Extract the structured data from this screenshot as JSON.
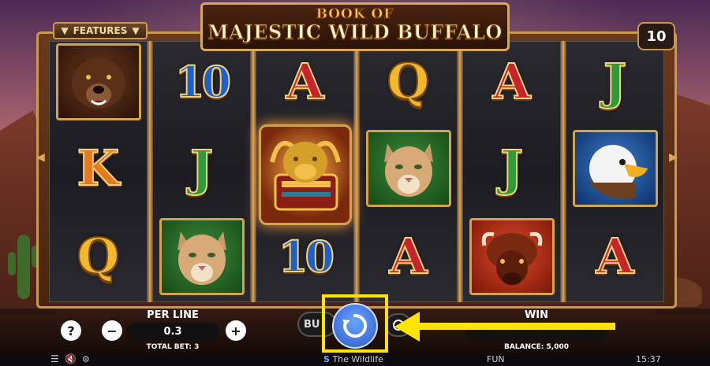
{
  "game": {
    "title_top": "BOOK OF",
    "title_main": "MAJESTIC WILD BUFFALO",
    "features_label": "FEATURES",
    "lines_count": "10"
  },
  "reels": [
    [
      "bear-icon",
      "K",
      "Q"
    ],
    [
      "10",
      "J",
      "cougar-icon"
    ],
    [
      "A",
      "book-icon",
      "10"
    ],
    [
      "Q",
      "cougar-icon",
      "A"
    ],
    [
      "A",
      "J",
      "bison-icon"
    ],
    [
      "J",
      "eagle-icon",
      "A"
    ]
  ],
  "symbols": {
    "k": "K",
    "q": "Q",
    "ten": "10",
    "j": "J",
    "a": "A"
  },
  "controls": {
    "help": "?",
    "minus": "−",
    "plus": "+",
    "per_line_label": "PER LINE",
    "per_line_value": "0.3",
    "total_bet": "TOTAL BET: 3",
    "buy_label": "BU",
    "win_label": "WIN",
    "balance": "BALANCE: 5,000"
  },
  "status_bar": {
    "brand": "The Wildlife",
    "mode": "FUN",
    "clock": "15:37"
  },
  "colors": {
    "highlight": "#ffe400",
    "spin": "#2a5acb",
    "frame_gold": "#d7a85a"
  }
}
